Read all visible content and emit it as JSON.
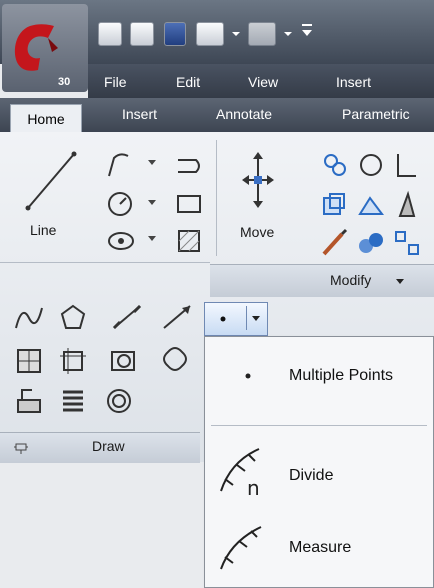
{
  "app": {
    "version": "30"
  },
  "menubar": {
    "items": [
      "File",
      "Edit",
      "View",
      "Insert"
    ]
  },
  "ribbon": {
    "tabs": [
      "Home",
      "Insert",
      "Annotate",
      "Parametric"
    ],
    "draw_panel": {
      "line_label": "Line",
      "title": "Draw"
    },
    "modify_panel": {
      "move_label": "Move",
      "title": "Modify"
    }
  },
  "dropdown": {
    "items": [
      {
        "label": "Multiple Points",
        "icon": "point-icon"
      },
      {
        "label": "Divide",
        "icon": "divide-icon"
      },
      {
        "label": "Measure",
        "icon": "measure-icon"
      }
    ]
  },
  "colors": {
    "accent_red": "#c4161c",
    "dark_bar": "#3e4755",
    "panel_bg": "#e6eaef"
  }
}
